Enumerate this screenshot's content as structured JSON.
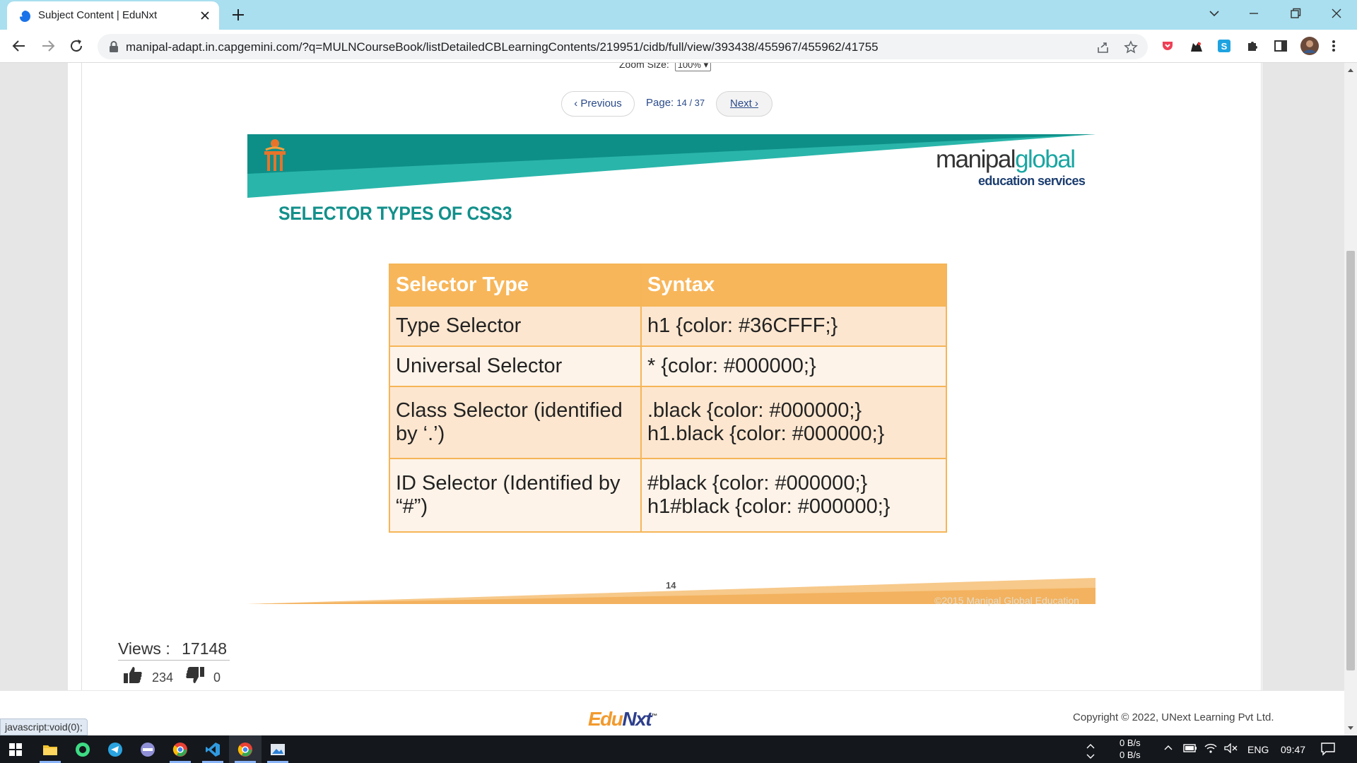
{
  "browser": {
    "tab_title": "Subject Content | EduNxt",
    "url": "manipal-adapt.in.capgemini.com/?q=MULNCourseBook/listDetailedCBLearningContents/219951/cidb/full/view/393438/455967/455962/41755"
  },
  "viewer": {
    "zoom_label": "Zoom Size:",
    "zoom_value": "100%",
    "prev_label": "‹ Previous",
    "next_label": "Next ›",
    "page_label": "Page:",
    "page_numbers": "14 / 37",
    "page_progress": {
      "current": 14,
      "total": 37
    }
  },
  "slide": {
    "title": "SELECTOR TYPES OF CSS3",
    "brand_dark": "manipal",
    "brand_light": "global",
    "brand_sub": "education services",
    "table": {
      "headers": [
        "Selector Type",
        "Syntax"
      ],
      "rows": [
        {
          "type": "Type Selector",
          "syntax": [
            "h1 {color: #36CFFF;}"
          ]
        },
        {
          "type": "Universal Selector",
          "syntax": [
            "* {color: #000000;}"
          ]
        },
        {
          "type": "Class Selector (identified by ‘.’)",
          "syntax": [
            ".black {color: #000000;}",
            "h1.black {color: #000000;}"
          ]
        },
        {
          "type": "ID Selector (Identified by “#”)",
          "syntax": [
            "#black {color: #000000;}",
            "h1#black {color: #000000;}"
          ]
        }
      ]
    },
    "slide_number": "14",
    "copyright": "©2015 Manipal Global Education"
  },
  "stats": {
    "views_label": "Views :",
    "views": "17148",
    "likes": "234",
    "dislikes": "0"
  },
  "footer": {
    "logo_a": "Edu",
    "logo_b": "N",
    "logo_c": "xt",
    "logo_tm": "™",
    "copyright": "Copyright © 2022, UNext Learning Pvt Ltd."
  },
  "status_bar": "javascript:void(0);",
  "taskbar": {
    "net_up": "0 B/s",
    "net_down": "0 B/s",
    "lang": "ENG",
    "time": "09:47"
  },
  "colors": {
    "tabstrip": "#a9dfef",
    "teal": "#13908b",
    "orange": "#f5b557",
    "link": "#2a4a8a"
  }
}
